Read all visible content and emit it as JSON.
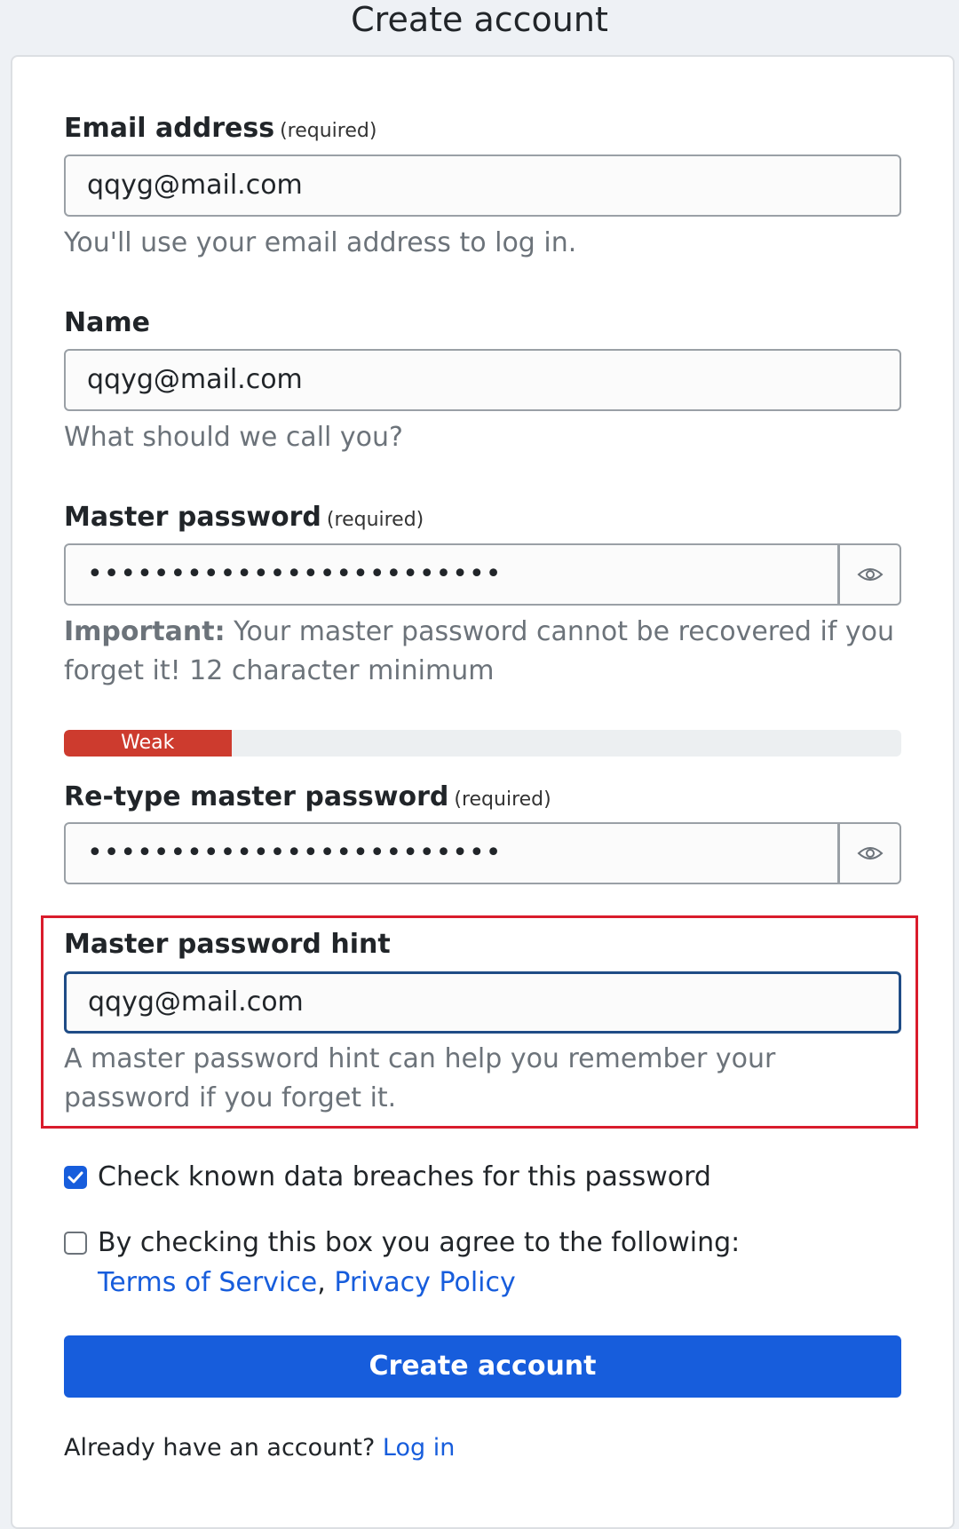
{
  "page": {
    "title": "Create account"
  },
  "email": {
    "label": "Email address",
    "required": "(required)",
    "value": "qqyg@mail.com",
    "helper": "You'll use your email address to log in."
  },
  "name": {
    "label": "Name",
    "value": "qqyg@mail.com",
    "helper": "What should we call you?"
  },
  "master_password": {
    "label": "Master password",
    "required": "(required)",
    "value": "•••••••••••••••••••••••••",
    "helper_bold": "Important:",
    "helper": " Your master password cannot be recovered if you forget it! 12 character minimum",
    "toggle_icon": "eye-icon"
  },
  "strength": {
    "label": "Weak",
    "level_fraction": 0.2,
    "color": "#cd3b2e"
  },
  "retype_password": {
    "label": "Re-type master password",
    "required": "(required)",
    "value": "•••••••••••••••••••••••••",
    "toggle_icon": "eye-icon"
  },
  "hint": {
    "label": "Master password hint",
    "value": "qqyg@mail.com",
    "helper": "A master password hint can help you remember your password if you forget it."
  },
  "breach_check": {
    "label": "Check known data breaches for this password",
    "checked": true
  },
  "agree": {
    "label": "By checking this box you agree to the following:",
    "checked": false,
    "terms_link": "Terms of Service",
    "separator": ",",
    "privacy_link": "Privacy Policy"
  },
  "submit": {
    "label": "Create account",
    "color": "#175ddc"
  },
  "footer": {
    "text": "Already have an account?",
    "login_link": "Log in"
  },
  "colors": {
    "accent": "#175ddc",
    "highlight_border": "#d91c2c",
    "focus_border": "#1f4c86"
  }
}
